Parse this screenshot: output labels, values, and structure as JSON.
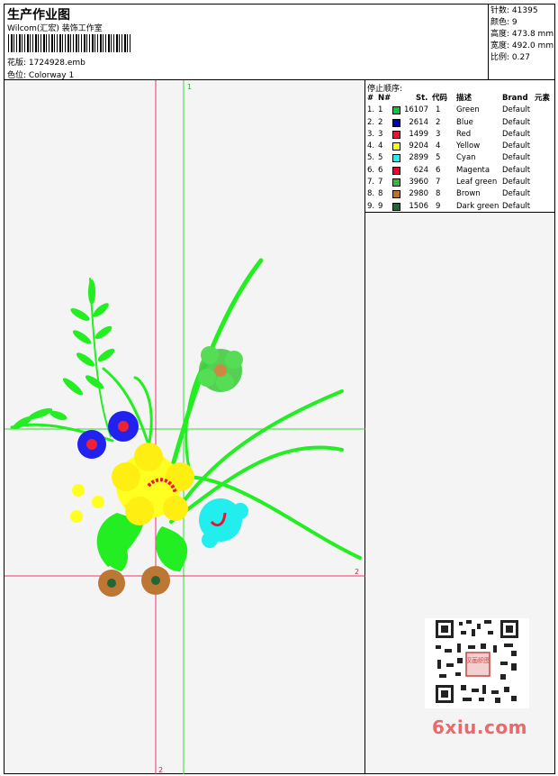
{
  "header": {
    "title": "生产作业图",
    "studio": "Wilcom(汇宏) 装饰工作室",
    "design_label": "花版:",
    "design_value": "1724928.emb",
    "colorway_label": "色位:",
    "colorway_value": "Colorway 1"
  },
  "stats": [
    {
      "label": "针数:",
      "value": "41395"
    },
    {
      "label": "颜色:",
      "value": "9"
    },
    {
      "label": "高度:",
      "value": "473.8 mm"
    },
    {
      "label": "宽度:",
      "value": "492.0 mm"
    },
    {
      "label": "比例:",
      "value": "0.27"
    }
  ],
  "stop_sequence": {
    "title": "停止顺序:",
    "headers": {
      "num": "#",
      "needle": "N#",
      "stitches": "St.",
      "code": "代码",
      "desc": "描述",
      "brand": "Brand",
      "element": "元素"
    },
    "rows": [
      {
        "num": "1.",
        "needle": "1",
        "color": "#00cc33",
        "stitches": "16107",
        "code": "1",
        "desc": "Green",
        "brand": "Default"
      },
      {
        "num": "2.",
        "needle": "2",
        "color": "#0000cc",
        "stitches": "2614",
        "code": "2",
        "desc": "Blue",
        "brand": "Default"
      },
      {
        "num": "3.",
        "needle": "3",
        "color": "#ee1133",
        "stitches": "1499",
        "code": "3",
        "desc": "Red",
        "brand": "Default"
      },
      {
        "num": "4.",
        "needle": "4",
        "color": "#ffff00",
        "stitches": "9204",
        "code": "4",
        "desc": "Yellow",
        "brand": "Default"
      },
      {
        "num": "5.",
        "needle": "5",
        "color": "#22eeee",
        "stitches": "2899",
        "code": "5",
        "desc": "Cyan",
        "brand": "Default"
      },
      {
        "num": "6.",
        "needle": "6",
        "color": "#ee0033",
        "stitches": "624",
        "code": "6",
        "desc": "Magenta",
        "brand": "Default"
      },
      {
        "num": "7.",
        "needle": "7",
        "color": "#33bb33",
        "stitches": "3960",
        "code": "7",
        "desc": "Leaf green",
        "brand": "Default"
      },
      {
        "num": "8.",
        "needle": "8",
        "color": "#b87333",
        "stitches": "2980",
        "code": "8",
        "desc": "Brown",
        "brand": "Default"
      },
      {
        "num": "9.",
        "needle": "9",
        "color": "#226633",
        "stitches": "1506",
        "code": "9",
        "desc": "Dark green",
        "brand": "Default"
      }
    ]
  },
  "canvas": {
    "marker_top": "1",
    "marker_right": "2",
    "marker_bottom": "2"
  },
  "watermark": {
    "qr_stamp": "汉画织图",
    "logo": "6xiu.com"
  }
}
